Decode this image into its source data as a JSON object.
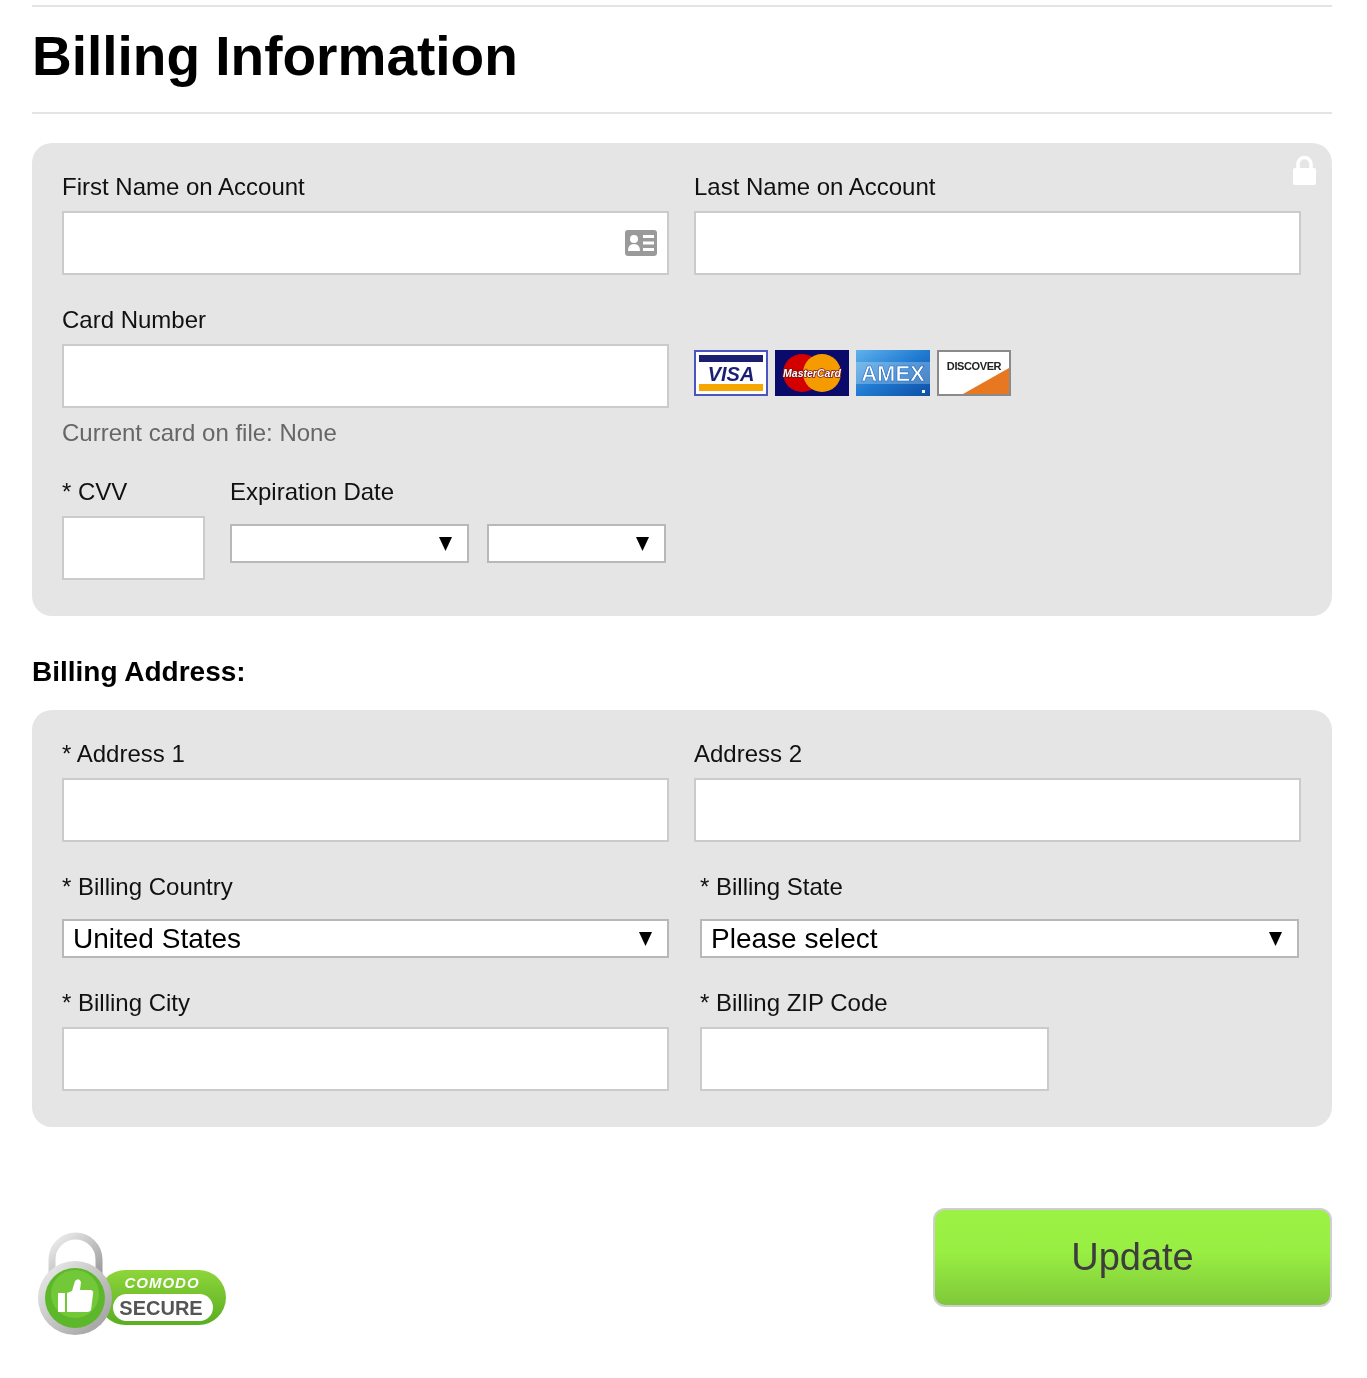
{
  "page": {
    "title": "Billing Information"
  },
  "card_panel": {
    "first_name": {
      "label": "First Name on Account"
    },
    "last_name": {
      "label": "Last Name on Account"
    },
    "card_number": {
      "label": "Card Number",
      "note": "Current card on file: None"
    },
    "card_logos": [
      {
        "kind": "visa",
        "text": "VISA"
      },
      {
        "kind": "mastercard",
        "text": "MasterCard"
      },
      {
        "kind": "amex",
        "text": "AMEX"
      },
      {
        "kind": "discover",
        "text": "DISCOVER"
      }
    ],
    "cvv": {
      "label": "* CVV"
    },
    "expiration": {
      "label": "Expiration Date"
    }
  },
  "address_heading": "Billing Address:",
  "address_panel": {
    "address_1": {
      "label": "* Address 1"
    },
    "address_2": {
      "label": "Address 2"
    },
    "country": {
      "label": "* Billing Country",
      "value": "United States"
    },
    "state": {
      "label": "* Billing State",
      "value": "Please select"
    },
    "city": {
      "label": "* Billing City"
    },
    "zip": {
      "label": "* Billing ZIP Code"
    }
  },
  "footer": {
    "badge": {
      "line_1": "COMODO",
      "line_2": "SECURE"
    },
    "update_button": "Update"
  }
}
